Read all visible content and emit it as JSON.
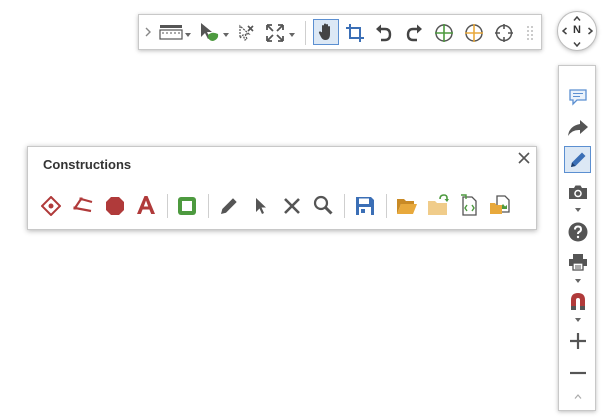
{
  "constructions_panel": {
    "title": "Constructions"
  },
  "navigation": {
    "north_label": "N"
  },
  "toolbar": {
    "selected_tool": "pan-hand-icon"
  },
  "colors": {
    "accent_blue": "#3b6fb6",
    "selection_fill": "#dce8f5",
    "construction_red": "#b03a3a",
    "construction_green": "#4d9a3f",
    "icon_gray": "#555555",
    "folder_orange": "#e8a93c"
  }
}
